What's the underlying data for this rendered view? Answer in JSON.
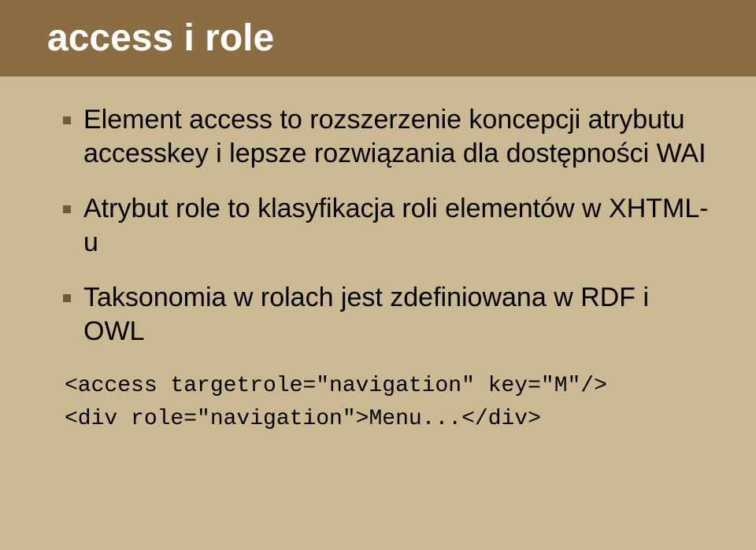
{
  "title": "access i role",
  "bullets": [
    "Element access to rozszerzenie koncepcji atrybutu accesskey i lepsze rozwiązania dla dostępności WAI",
    "Atrybut role to klasyfikacja roli elementów w XHTML-u",
    "Taksonomia w rolach jest zdefiniowana w RDF i OWL"
  ],
  "code_lines": [
    "<access targetrole=\"navigation\" key=\"M\"/>",
    "<div role=\"navigation\">Menu...</div>"
  ]
}
